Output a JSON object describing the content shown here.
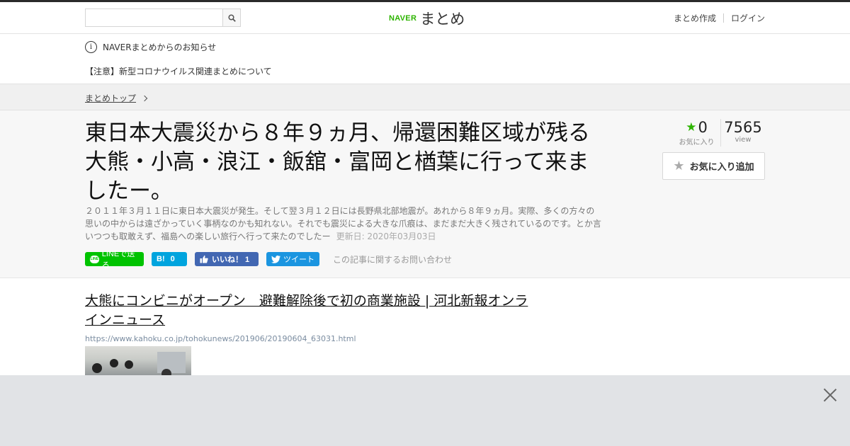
{
  "header": {
    "search": {
      "placeholder": "",
      "value": ""
    },
    "logo": {
      "naver": "NAVER",
      "matome": "まとめ"
    },
    "links": [
      "まとめ作成",
      "ログイン"
    ]
  },
  "notice": {
    "heading": "NAVERまとめからのお知らせ",
    "link": "【注意】新型コロナウイルス関連まとめについて"
  },
  "breadcrumb": {
    "top": "まとめトップ"
  },
  "matome": {
    "title": "東日本大震災から８年９ヵ月、帰還困難区域が残る大熊・小高・浪江・飯舘・富岡と楢葉に行って来ましたー。",
    "description": "２０１１年３月１１日に東日本大震災が発生。そして翌３月１２日には長野県北部地震が。あれから８年９ヵ月。実際、多くの方々の思いの中からは遠ざかっていく事柄なのかも知れない。それでも震災による大きな爪痕は、まだまだ大きく残されているのです。とか言いつつも取敢えず、福島への楽しい旅行へ行って来たのでしたー",
    "updated": "更新日: 2020年03月03日",
    "favorites": "0",
    "favorites_label": "お気に入り",
    "views": "7565",
    "views_label": "view",
    "fav_button": "お気に入り追加"
  },
  "share": {
    "line": "LINEで送る",
    "hatena_count": "0",
    "facebook": "いいね！ 1",
    "twitter": "ツイート",
    "inquiry": "この記事に関するお問い合わせ"
  },
  "article": {
    "title": "大熊にコンビニがオープン　避難解除後で初の商業施設 | 河北新報オンラインニュース",
    "url": "https://www.kahoku.co.jp/tohokunews/201906/20190604_63031.html"
  },
  "colors": {
    "naver_green": "#2db400",
    "line": "#00c300",
    "hatena": "#00a4de",
    "facebook": "#4267b2",
    "twitter": "#1b95e0"
  }
}
